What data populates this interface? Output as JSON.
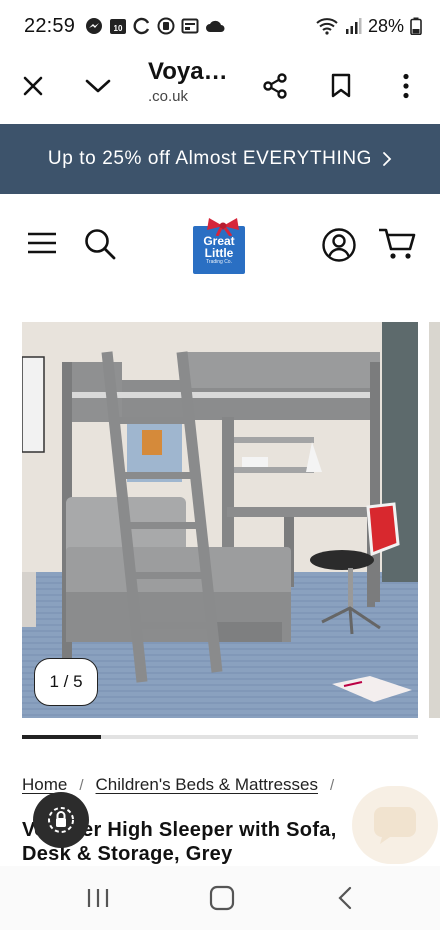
{
  "status_bar": {
    "time": "22:59",
    "battery": "28%",
    "left_icons": [
      "messenger-icon",
      "calendar-icon",
      "sync-icon",
      "data-saver-icon",
      "screen-icon",
      "cloud-icon"
    ],
    "right_icons": [
      "wifi-icon",
      "signal-icon",
      "battery-icon"
    ],
    "calendar_day": "10"
  },
  "browser": {
    "title": "Voya…",
    "url": ".co.uk"
  },
  "promo": {
    "text": "Up to 25% off Almost EVERYTHING"
  },
  "header": {
    "logo": {
      "line1": "Great",
      "line2": "Little",
      "line3": "Trading Co."
    }
  },
  "gallery": {
    "counter": "1 / 5",
    "current": 1,
    "total": 5,
    "progress_fraction": 0.2
  },
  "breadcrumb": {
    "items": [
      "Home",
      "Children's Beds & Mattresses"
    ],
    "separator": "/"
  },
  "product": {
    "title": "Voyager High Sleeper with Sofa, Desk & Storage, Grey"
  },
  "colors": {
    "promo_bg": "#3d536b",
    "logo_blue": "#2a6fc3",
    "logo_bow": "#d6263b",
    "chair_red": "#d8282e"
  }
}
